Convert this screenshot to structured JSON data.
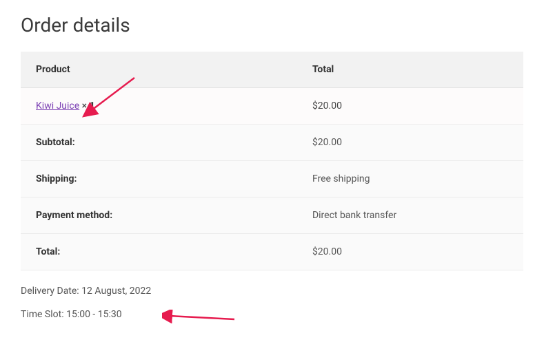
{
  "title": "Order details",
  "headers": {
    "product": "Product",
    "total": "Total"
  },
  "line_item": {
    "product_name": "Kiwi Juice",
    "qty_prefix": " × ",
    "qty": "1",
    "line_total": "$20.00"
  },
  "footer_rows": [
    {
      "label": "Subtotal:",
      "value": "$20.00"
    },
    {
      "label": "Shipping:",
      "value": "Free shipping"
    },
    {
      "label": "Payment method:",
      "value": "Direct bank transfer"
    },
    {
      "label": "Total:",
      "value": "$20.00"
    }
  ],
  "delivery_date_label": "Delivery Date: ",
  "delivery_date_value": "12 August, 2022",
  "time_slot_label": "Time Slot: ",
  "time_slot_value": "15:00 - 15:30"
}
